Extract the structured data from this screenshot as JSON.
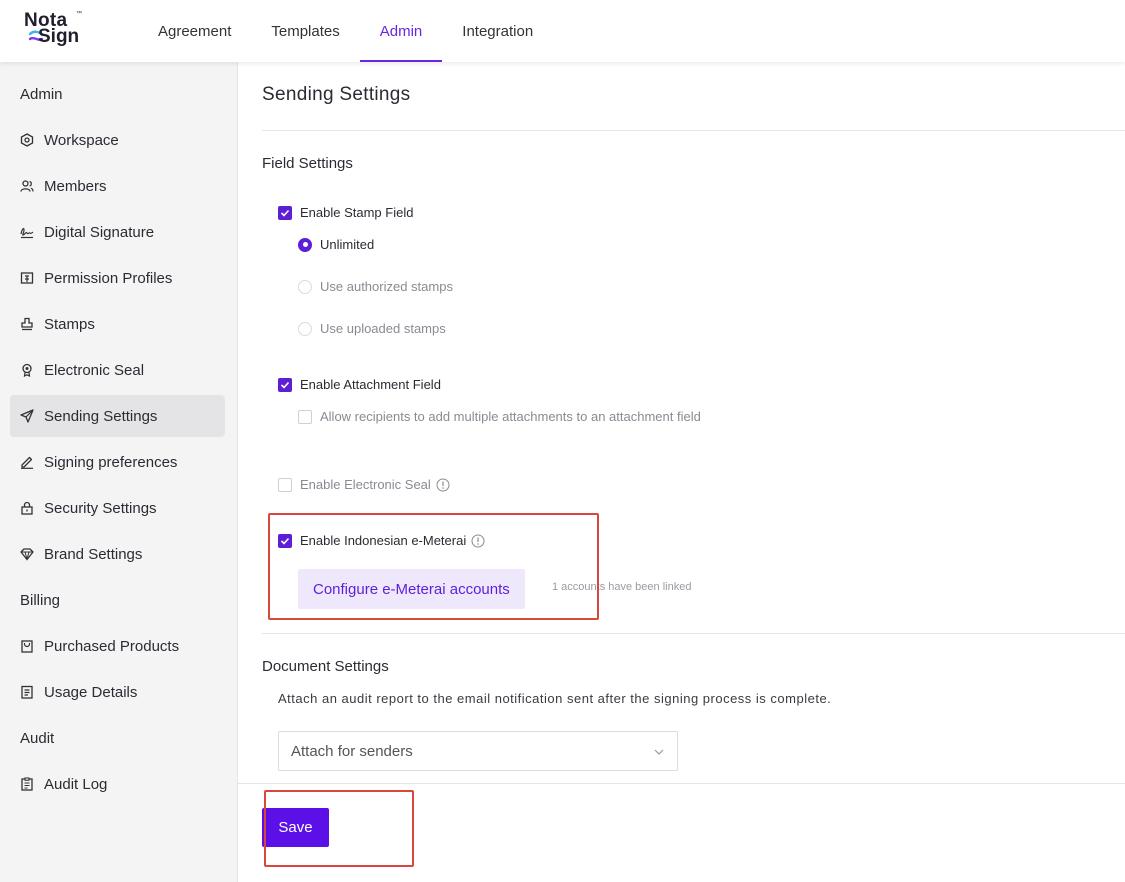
{
  "brand": {
    "logo_line1": "Nota",
    "logo_tm": "™",
    "logo_line2": "Sign",
    "accent": "#5c1fd6",
    "swoosh_colors": [
      "#3fb6e6",
      "#7a3cf0"
    ]
  },
  "topnav": {
    "items": [
      {
        "label": "Agreement"
      },
      {
        "label": "Templates"
      },
      {
        "label": "Admin",
        "active": true
      },
      {
        "label": "Integration"
      }
    ]
  },
  "sidebar": {
    "groups": {
      "admin": "Admin",
      "billing": "Billing",
      "audit": "Audit"
    },
    "items": [
      {
        "label": "Workspace",
        "icon": "workspace-icon"
      },
      {
        "label": "Members",
        "icon": "members-icon"
      },
      {
        "label": "Digital Signature",
        "icon": "signature-icon"
      },
      {
        "label": "Permission Profiles",
        "icon": "permission-icon"
      },
      {
        "label": "Stamps",
        "icon": "stamp-icon"
      },
      {
        "label": "Electronic Seal",
        "icon": "seal-icon"
      },
      {
        "label": "Sending Settings",
        "icon": "send-icon",
        "active": true
      },
      {
        "label": "Signing preferences",
        "icon": "pen-icon"
      },
      {
        "label": "Security Settings",
        "icon": "lock-icon"
      },
      {
        "label": "Brand Settings",
        "icon": "diamond-icon"
      },
      {
        "label": "Purchased Products",
        "icon": "bag-icon"
      },
      {
        "label": "Usage Details",
        "icon": "document-icon"
      },
      {
        "label": "Audit Log",
        "icon": "clipboard-icon"
      }
    ]
  },
  "main": {
    "title": "Sending Settings",
    "field_settings": {
      "title": "Field Settings",
      "stamp": {
        "label": "Enable Stamp Field",
        "checked": true,
        "options": [
          {
            "label": "Unlimited",
            "selected": true
          },
          {
            "label": "Use authorized stamps",
            "selected": false
          },
          {
            "label": "Use uploaded stamps",
            "selected": false
          }
        ]
      },
      "attachment": {
        "label": "Enable Attachment Field",
        "checked": true,
        "sub_label": "Allow recipients to add multiple attachments to an attachment field",
        "sub_checked": false
      },
      "electronic_seal": {
        "label": "Enable Electronic Seal",
        "checked": false
      },
      "emeterai": {
        "label": "Enable Indonesian e-Meterai",
        "checked": true,
        "configure_label": "Configure e-Meterai accounts",
        "linked_note": "1 accounts have been linked"
      }
    },
    "document_settings": {
      "title": "Document Settings",
      "description": "Attach an audit report to the email notification sent after the signing process is complete.",
      "select_value": "Attach for senders"
    },
    "save_label": "Save"
  }
}
